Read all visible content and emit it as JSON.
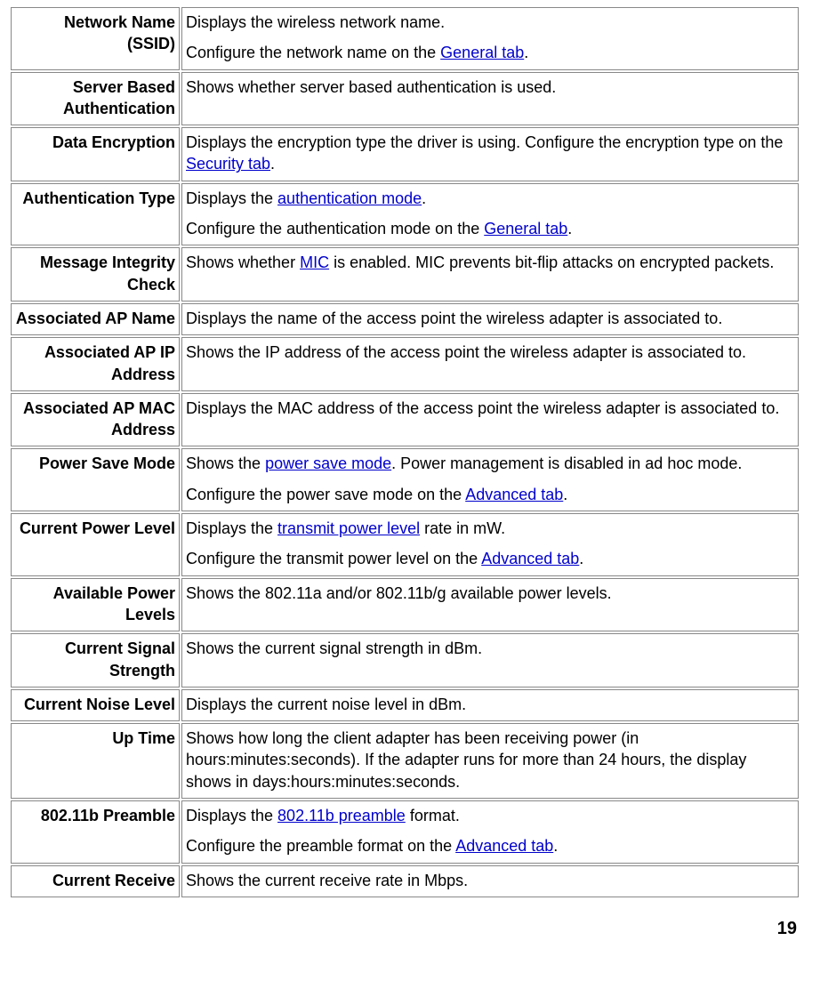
{
  "rows": [
    {
      "label": "Network Name (SSID)",
      "desc": [
        [
          {
            "t": "Displays the wireless network name."
          }
        ],
        [
          {
            "t": "Configure the network name on the "
          },
          {
            "t": "General tab",
            "link": true
          },
          {
            "t": "."
          }
        ]
      ]
    },
    {
      "label": "Server Based Authentication",
      "desc": [
        [
          {
            "t": "Shows whether server based authentication is used."
          }
        ]
      ]
    },
    {
      "label": "Data Encryption",
      "desc": [
        [
          {
            "t": "Displays the encryption type the driver is using.   Configure the encryption type on the "
          },
          {
            "t": "Security tab",
            "link": true
          },
          {
            "t": "."
          }
        ]
      ]
    },
    {
      "label": "Authentication Type",
      "desc": [
        [
          {
            "t": "Displays the "
          },
          {
            "t": "authentication mode",
            "link": true
          },
          {
            "t": "."
          }
        ],
        [
          {
            "t": "Configure the authentication mode on the "
          },
          {
            "t": "General tab",
            "link": true
          },
          {
            "t": "."
          }
        ]
      ]
    },
    {
      "label": "Message Integrity Check",
      "desc": [
        [
          {
            "t": "Shows whether "
          },
          {
            "t": "MIC",
            "link": true
          },
          {
            "t": " is enabled. MIC prevents bit-flip attacks on encrypted packets."
          }
        ]
      ]
    },
    {
      "label": "Associated AP Name",
      "desc": [
        [
          {
            "t": "Displays the name of the access point the wireless adapter is associated to."
          }
        ]
      ]
    },
    {
      "label": "Associated AP IP Address",
      "desc": [
        [
          {
            "t": "Shows the IP address of the access point the wireless adapter is associated to."
          }
        ]
      ]
    },
    {
      "label": "Associated AP MAC Address",
      "desc": [
        [
          {
            "t": "Displays the MAC address of the access point the wireless adapter is associated to."
          }
        ]
      ]
    },
    {
      "label": "Power Save Mode",
      "desc": [
        [
          {
            "t": "Shows the "
          },
          {
            "t": "power save mode",
            "link": true
          },
          {
            "t": ". Power management is disabled in ad hoc mode."
          }
        ],
        [
          {
            "t": "Configure the power save mode on the "
          },
          {
            "t": "Advanced tab",
            "link": true
          },
          {
            "t": "."
          }
        ]
      ]
    },
    {
      "label": "Current Power Level",
      "desc": [
        [
          {
            "t": "Displays the "
          },
          {
            "t": "transmit power level",
            "link": true
          },
          {
            "t": " rate in mW."
          }
        ],
        [
          {
            "t": "Configure the transmit power level on the "
          },
          {
            "t": "Advanced tab",
            "link": true
          },
          {
            "t": "."
          }
        ]
      ]
    },
    {
      "label": "Available Power Levels",
      "desc": [
        [
          {
            "t": "Shows the 802.11a and/or 802.11b/g available power levels."
          }
        ]
      ]
    },
    {
      "label": "Current Signal Strength",
      "desc": [
        [
          {
            "t": "Shows the current signal strength in dBm."
          }
        ]
      ]
    },
    {
      "label": "Current Noise Level",
      "desc": [
        [
          {
            "t": "Displays the current noise level in dBm."
          }
        ]
      ]
    },
    {
      "label": "Up Time",
      "desc": [
        [
          {
            "t": "Shows how long the client adapter has been receiving power (in hours:minutes:seconds). If the adapter runs for more than 24 hours, the display shows in days:hours:minutes:seconds."
          }
        ]
      ]
    },
    {
      "label": "802.11b Preamble",
      "desc": [
        [
          {
            "t": "Displays the "
          },
          {
            "t": "802.11b preamble",
            "link": true
          },
          {
            "t": " format."
          }
        ],
        [
          {
            "t": "Configure the preamble format on the "
          },
          {
            "t": "Advanced tab",
            "link": true
          },
          {
            "t": "."
          }
        ]
      ]
    },
    {
      "label": "Current Receive",
      "desc": [
        [
          {
            "t": "Shows the current receive rate in Mbps."
          }
        ]
      ]
    }
  ],
  "page_number": "19"
}
